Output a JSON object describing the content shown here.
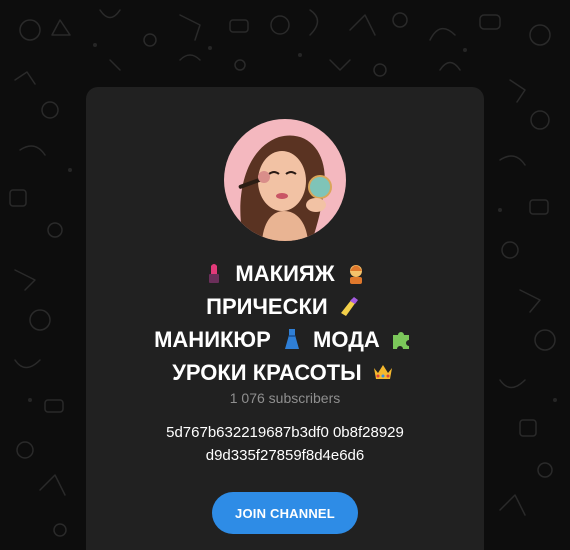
{
  "channel": {
    "title_lines": [
      {
        "text_a": "МАКИЯЖ",
        "text_b": ""
      },
      {
        "text_a": "ПРИЧЕСКИ",
        "text_b": ""
      },
      {
        "text_a": "МАНИКЮР",
        "text_b": "МОДА"
      },
      {
        "text_a": "УРОКИ КРАСОТЫ",
        "text_b": ""
      }
    ],
    "emojis": [
      "lipstick-icon",
      "haircut-icon",
      "nail-polish-icon",
      "dress-icon",
      "puzzle-piece-icon",
      "crown-icon"
    ],
    "subscribers": "1 076 subscribers",
    "description_lines": [
      "5d767b632219687b3df0 0b8f28929",
      "d9d335f27859f8d4e6d6"
    ],
    "join_label": "JOIN CHANNEL"
  },
  "colors": {
    "background": "#0d0d0d",
    "card": "#212121",
    "accent": "#2e8ce6",
    "muted_text": "#8f8f8f"
  }
}
